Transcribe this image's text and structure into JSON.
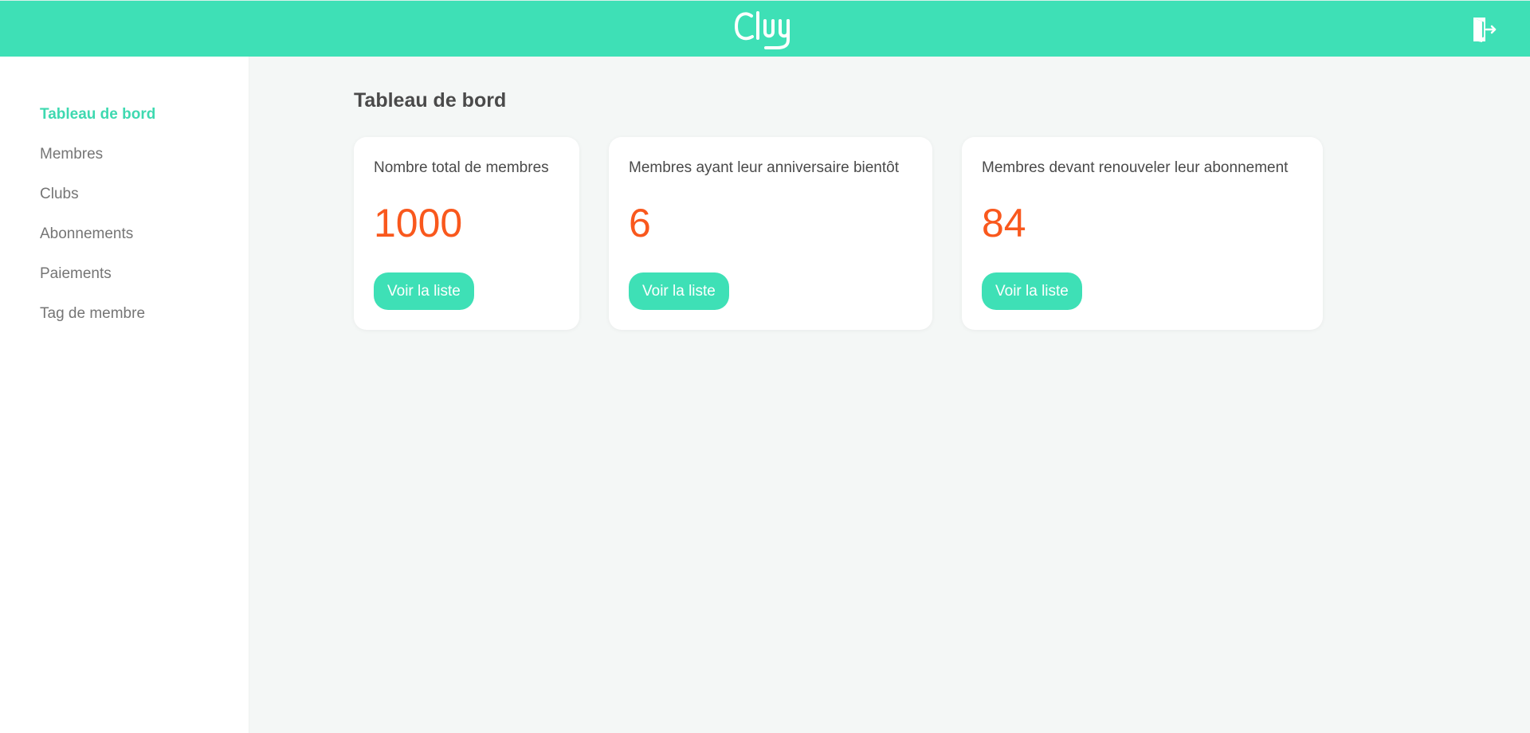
{
  "header": {
    "logo_text": "Clug",
    "logo_icon": "clug-logo",
    "logout_icon": "logout-door-icon",
    "bg_color": "#3ee0b6"
  },
  "sidebar": {
    "items": [
      {
        "label": "Tableau de bord",
        "active": true
      },
      {
        "label": "Membres",
        "active": false
      },
      {
        "label": "Clubs",
        "active": false
      },
      {
        "label": "Abonnements",
        "active": false
      },
      {
        "label": "Paiements",
        "active": false
      },
      {
        "label": "Tag de membre",
        "active": false
      }
    ]
  },
  "main": {
    "title": "Tableau de bord",
    "cards": [
      {
        "title": "Nombre total de membres",
        "value": "1000",
        "button": "Voir la liste"
      },
      {
        "title": "Membres ayant leur anniversaire bientôt",
        "value": "6",
        "button": "Voir la liste"
      },
      {
        "title": "Membres devant renouveler leur abonnement",
        "value": "84",
        "button": "Voir la liste"
      }
    ]
  },
  "colors": {
    "accent": "#3ee0b6",
    "value": "#f9581d",
    "background": "#f4f7f6"
  }
}
